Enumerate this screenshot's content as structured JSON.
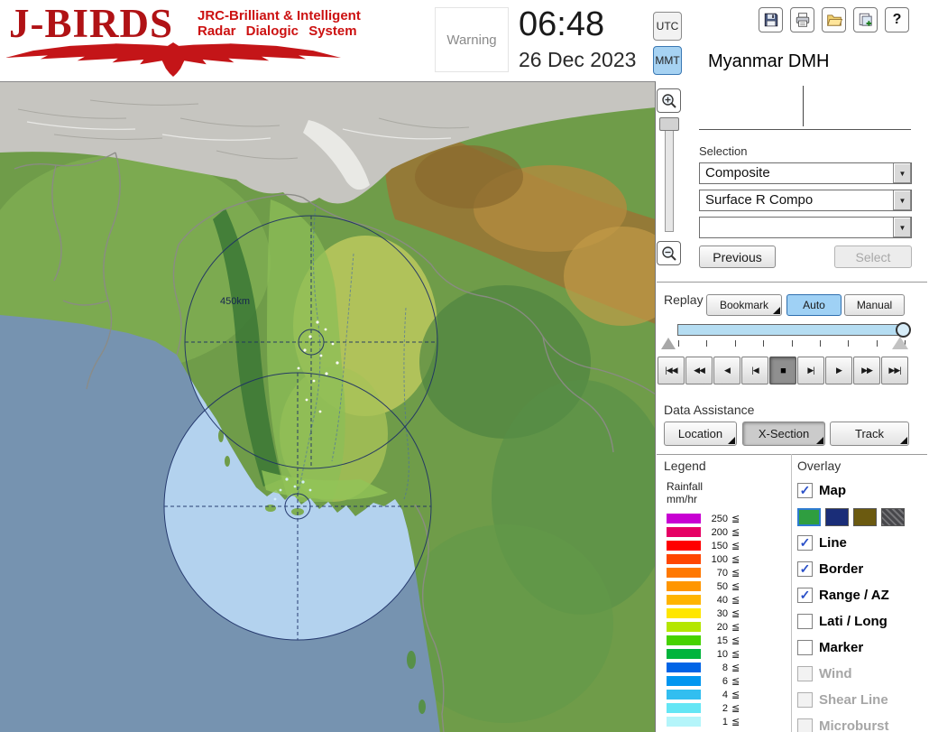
{
  "header": {
    "logo": {
      "title": "J-BIRDS",
      "subtitle1": "JRC-Brilliant & Intelligent",
      "subtitle2": "Radar Dialogic System"
    },
    "warning": "Warning",
    "time": "06:48",
    "date": "26 Dec 2023",
    "tz_utc": "UTC",
    "tz_mmt": "MMT",
    "tz_selected": "MMT",
    "site": "Myanmar DMH"
  },
  "icons": {
    "dropdown_arrow": "▼",
    "check": "✓",
    "help": "?"
  },
  "map": {
    "range_label": "450km"
  },
  "selection": {
    "label": "Selection",
    "dropdowns": [
      {
        "value": "Composite"
      },
      {
        "value": "Surface R Compo"
      },
      {
        "value": ""
      }
    ],
    "previous": "Previous",
    "select": "Select"
  },
  "replay": {
    "label": "Replay",
    "bookmark": "Bookmark",
    "auto": "Auto",
    "manual": "Manual",
    "playback": [
      "|◀◀",
      "◀◀",
      "◀",
      "|◀",
      "■",
      "▶|",
      "▶",
      "▶▶",
      "▶▶|"
    ],
    "active_index": 4
  },
  "assist": {
    "label": "Data Assistance",
    "buttons": [
      "Location",
      "X-Section",
      "Track"
    ],
    "active_index": 1
  },
  "legend": {
    "label": "Legend",
    "unit1": "Rainfall",
    "unit2": "mm/hr",
    "suffix": "≦",
    "entries": [
      {
        "value": "250",
        "color": "#c800d2"
      },
      {
        "value": "200",
        "color": "#e60064"
      },
      {
        "value": "150",
        "color": "#ff0000"
      },
      {
        "value": "100",
        "color": "#ff4600"
      },
      {
        "value": "70",
        "color": "#ff7800"
      },
      {
        "value": "50",
        "color": "#ff9600"
      },
      {
        "value": "40",
        "color": "#ffb400"
      },
      {
        "value": "30",
        "color": "#ffe600"
      },
      {
        "value": "20",
        "color": "#b4e600"
      },
      {
        "value": "15",
        "color": "#46d200"
      },
      {
        "value": "10",
        "color": "#00b43c"
      },
      {
        "value": "8",
        "color": "#0064e6"
      },
      {
        "value": "6",
        "color": "#0096f0"
      },
      {
        "value": "4",
        "color": "#32bef0"
      },
      {
        "value": "2",
        "color": "#64e6f5"
      },
      {
        "value": "1",
        "color": "#b4f5fa"
      }
    ]
  },
  "overlay": {
    "label": "Overlay",
    "map_swatches": [
      "#2f9e40",
      "#1a2d78",
      "#6b5a10",
      "#47474b"
    ],
    "items": [
      {
        "label": "Map",
        "checked": true,
        "enabled": true
      },
      {
        "label": "Line",
        "checked": true,
        "enabled": true
      },
      {
        "label": "Border",
        "checked": true,
        "enabled": true
      },
      {
        "label": "Range / AZ",
        "checked": true,
        "enabled": true
      },
      {
        "label": "Lati / Long",
        "checked": false,
        "enabled": true
      },
      {
        "label": "Marker",
        "checked": false,
        "enabled": true
      },
      {
        "label": "Wind",
        "checked": false,
        "enabled": false
      },
      {
        "label": "Shear Line",
        "checked": false,
        "enabled": false
      },
      {
        "label": "Microburst",
        "checked": false,
        "enabled": false
      }
    ]
  }
}
